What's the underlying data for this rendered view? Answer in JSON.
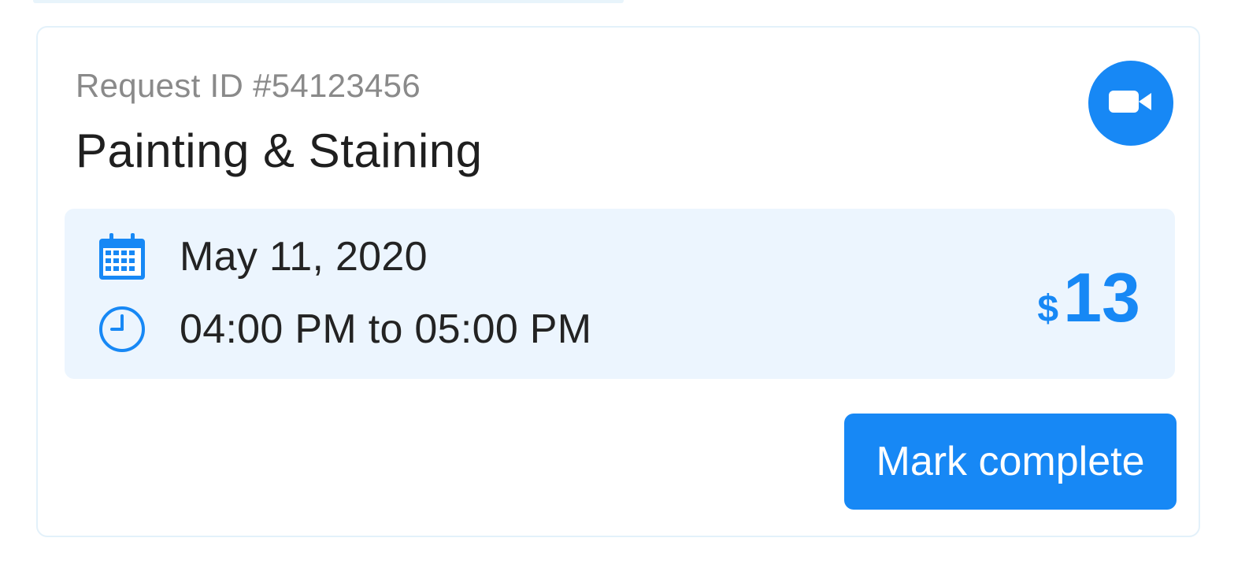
{
  "request": {
    "id_label": "Request ID #54123456",
    "service_title": "Painting & Staining"
  },
  "schedule": {
    "date": "May 11, 2020",
    "time_range": "04:00 PM to 05:00 PM"
  },
  "price": {
    "currency": "$",
    "amount": "13"
  },
  "actions": {
    "video_icon": "video-camera-icon",
    "mark_complete_label": "Mark complete"
  },
  "icons": {
    "date": "calendar-icon",
    "time": "clock-icon"
  },
  "colors": {
    "accent": "#1788f5",
    "panel_background": "#ecf5fe",
    "card_border": "#e3f1fa",
    "muted_text": "#8a8a8a",
    "primary_text": "#1f1f1f"
  }
}
